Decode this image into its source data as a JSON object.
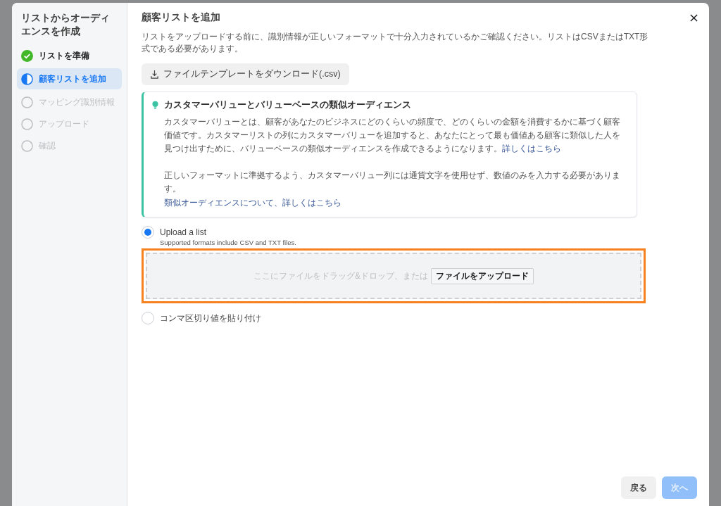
{
  "sidebar": {
    "title": "リストからオーディエンスを作成",
    "steps": [
      {
        "label": "リストを準備",
        "completed": true,
        "selected": false
      },
      {
        "label": "顧客リストを追加",
        "completed": false,
        "selected": true
      },
      {
        "label": "マッピング識別情報",
        "completed": false,
        "selected": false
      },
      {
        "label": "アップロード",
        "completed": false,
        "selected": false
      },
      {
        "label": "確認",
        "completed": false,
        "selected": false
      }
    ]
  },
  "dialog": {
    "title": "顧客リストを追加",
    "intro": "リストをアップロードする前に、識別情報が正しいフォーマットで十分入力されているかご確認ください。リストはCSVまたはTXT形式である必要があります。",
    "download_button": "ファイルテンプレートをダウンロード(.csv)",
    "tip": {
      "title": "カスタマーバリューとバリューベースの類似オーディエンス",
      "paragraph_1": "カスタマーバリューとは、顧客があなたのビジネスにどのくらいの頻度で、どのくらいの金額を消費するかに基づく顧客価値です。カスタマーリストの列にカスタマーバリューを追加すると、あなたにとって最も価値ある顧客に類似した人を見つけ出すために、バリューベースの類似オーディエンスを作成できるようになります。",
      "link_1": "詳しくはこちら",
      "paragraph_2": "正しいフォーマットに準拠するよう、カスタマーバリュー列には通貨文字を使用せず、数値のみを入力する必要があります。",
      "link_2": "類似オーディエンスについて、詳しくはこちら"
    },
    "options": [
      {
        "label": "Upload a list",
        "hint": "Supported formats include CSV and TXT files.",
        "selected": true
      },
      {
        "label": "コンマ区切り値を貼り付け",
        "selected": false
      }
    ],
    "dropzone": {
      "text": "ここにファイルをドラッグ&ドロップ、または",
      "button": "ファイルをアップロード",
      "highlighted": true
    },
    "footer": {
      "back": "戻る",
      "next": "次へ",
      "next_disabled": true
    }
  }
}
